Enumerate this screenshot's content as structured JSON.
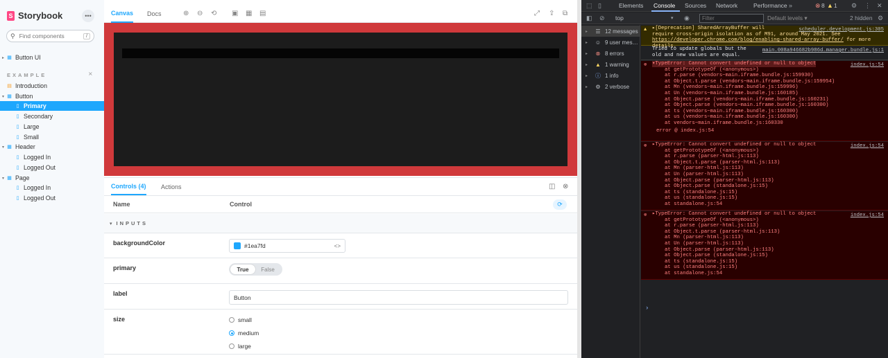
{
  "storybook": {
    "brand": "Storybook",
    "search_placeholder": "Find components",
    "search_shortcut": "/",
    "section_label": "EXAMPLE",
    "tree": [
      {
        "label": "Button UI",
        "kind": "comp",
        "caret": "▸"
      },
      {
        "label": "Introduction",
        "kind": "doc",
        "caret": ""
      },
      {
        "label": "Button",
        "kind": "comp",
        "caret": "▾"
      },
      {
        "label": "Primary",
        "kind": "story",
        "caret": "",
        "selected": true
      },
      {
        "label": "Secondary",
        "kind": "story",
        "caret": ""
      },
      {
        "label": "Large",
        "kind": "story",
        "caret": ""
      },
      {
        "label": "Small",
        "kind": "story",
        "caret": ""
      },
      {
        "label": "Header",
        "kind": "comp",
        "caret": "▾"
      },
      {
        "label": "Logged In",
        "kind": "story",
        "caret": ""
      },
      {
        "label": "Logged Out",
        "kind": "story",
        "caret": ""
      },
      {
        "label": "Page",
        "kind": "comp",
        "caret": "▾"
      },
      {
        "label": "Logged In",
        "kind": "story",
        "caret": ""
      },
      {
        "label": "Logged Out",
        "kind": "story",
        "caret": ""
      }
    ]
  },
  "toolbar": {
    "canvas_tab": "Canvas",
    "docs_tab": "Docs"
  },
  "panel": {
    "tabs": {
      "controls": "Controls (4)",
      "actions": "Actions"
    },
    "header": {
      "name": "Name",
      "control": "Control"
    },
    "section": "INPUTS",
    "props": {
      "backgroundColor": {
        "name": "backgroundColor",
        "value": "#1ea7fd"
      },
      "primary": {
        "name": "primary",
        "true_label": "True",
        "false_label": "False"
      },
      "label": {
        "name": "label",
        "value": "Button"
      },
      "size": {
        "name": "size",
        "options": [
          "small",
          "medium",
          "large"
        ],
        "selected": "medium"
      }
    }
  },
  "devtools": {
    "tabs": [
      "Elements",
      "Console",
      "Sources",
      "Network",
      "Performance"
    ],
    "active_tab": "Console",
    "error_count": "8",
    "warning_count": "1",
    "context": "top",
    "filter_placeholder": "Filter",
    "levels": "Default levels ▾",
    "hidden": "2 hidden",
    "sidebar": [
      {
        "label": "12 messages",
        "icon": "list-icon"
      },
      {
        "label": "9 user mes…",
        "icon": "user-icon"
      },
      {
        "label": "8 errors",
        "icon": "error-icon"
      },
      {
        "label": "1 warning",
        "icon": "warning-icon"
      },
      {
        "label": "1 info",
        "icon": "info-icon"
      },
      {
        "label": "2 verbose",
        "icon": "gear-icon"
      }
    ],
    "log": {
      "warn_text1": "▸[Deprecation] SharedArrayBuffer will",
      "warn_src": "scheduler.development.js:305",
      "warn_text2": "require cross-origin isolation as of M91, around May 2021. See",
      "warn_link": "https://developer.chrome.com/blog/enabling-shared-array-buffer/",
      "warn_text3": "for more details.",
      "info_text1": "Tried to update globals but the",
      "info_src": "main.008a946682b986d…manager.bundle.js:1",
      "info_text2": "old and new values are equal.",
      "err1_title": "▾TypeError: Cannot convert undefined or null to object",
      "err1_src": "index.js:54",
      "err1_stack": [
        "at getPrototypeOf (<anonymous>)",
        "at r.parse (vendors~main.iframe.bundle.js:159930)",
        "at Object.t.parse (vendors~main.iframe.bundle.js:159954)",
        "at Mn (vendors~main.iframe.bundle.js:159996)",
        "at Un (vendors~main.iframe.bundle.js:160185)",
        "at Object.parse (vendors~main.iframe.bundle.js:160231)",
        "at Object.parse (vendors~main.iframe.bundle.js:160300)",
        "at ts (vendors~main.iframe.bundle.js:160300)",
        "at us (vendors~main.iframe.bundle.js:160300)",
        "at vendors~main.iframe.bundle.js:160330"
      ],
      "err1_footer": "error @ index.js:54",
      "err2_title": "▸TypeError: Cannot convert undefined or null to object",
      "err2_src": "index.js:54",
      "err2_stack": [
        "at getPrototypeOf (<anonymous>)",
        "at r.parse (parser-html.js:113)",
        "at Object.t.parse (parser-html.js:113)",
        "at Mn (parser-html.js:113)",
        "at Un (parser-html.js:113)",
        "at Object.parse (parser-html.js:113)",
        "at Object.parse (standalone.js:15)",
        "at ts (standalone.js:15)",
        "at us (standalone.js:15)",
        "at standalone.js:54"
      ],
      "err3_title": "▸TypeError: Cannot convert undefined or null to object",
      "err3_src": "index.js:54",
      "err3_stack": [
        "at getPrototypeOf (<anonymous>)",
        "at r.parse (parser-html.js:113)",
        "at Object.t.parse (parser-html.js:113)",
        "at Mn (parser-html.js:113)",
        "at Un (parser-html.js:113)",
        "at Object.parse (parser-html.js:113)",
        "at Object.parse (standalone.js:15)",
        "at ts (standalone.js:15)",
        "at us (standalone.js:15)",
        "at standalone.js:54"
      ]
    }
  },
  "colors": {
    "accent": "#1ea7fd",
    "brand": "#ff4785",
    "canvas_border": "#d0393b",
    "story_bg": "#1c1c1c"
  }
}
